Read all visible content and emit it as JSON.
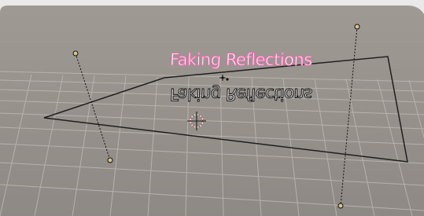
{
  "viewport": {
    "name": "3d-viewport",
    "background_color": "#9a9590",
    "grid_color": "#b9b4af",
    "frame_color": "#1f1f1f"
  },
  "scene": {
    "title_text": "Faking Reflections",
    "reflection_text": "Faking Reflections",
    "text_outline_color": "#f06eb4",
    "reflection_outline_color": "#111111",
    "lamp_color": "#d6c48a",
    "cursor_colors": [
      "#d13a3a",
      "#ffffff"
    ]
  }
}
